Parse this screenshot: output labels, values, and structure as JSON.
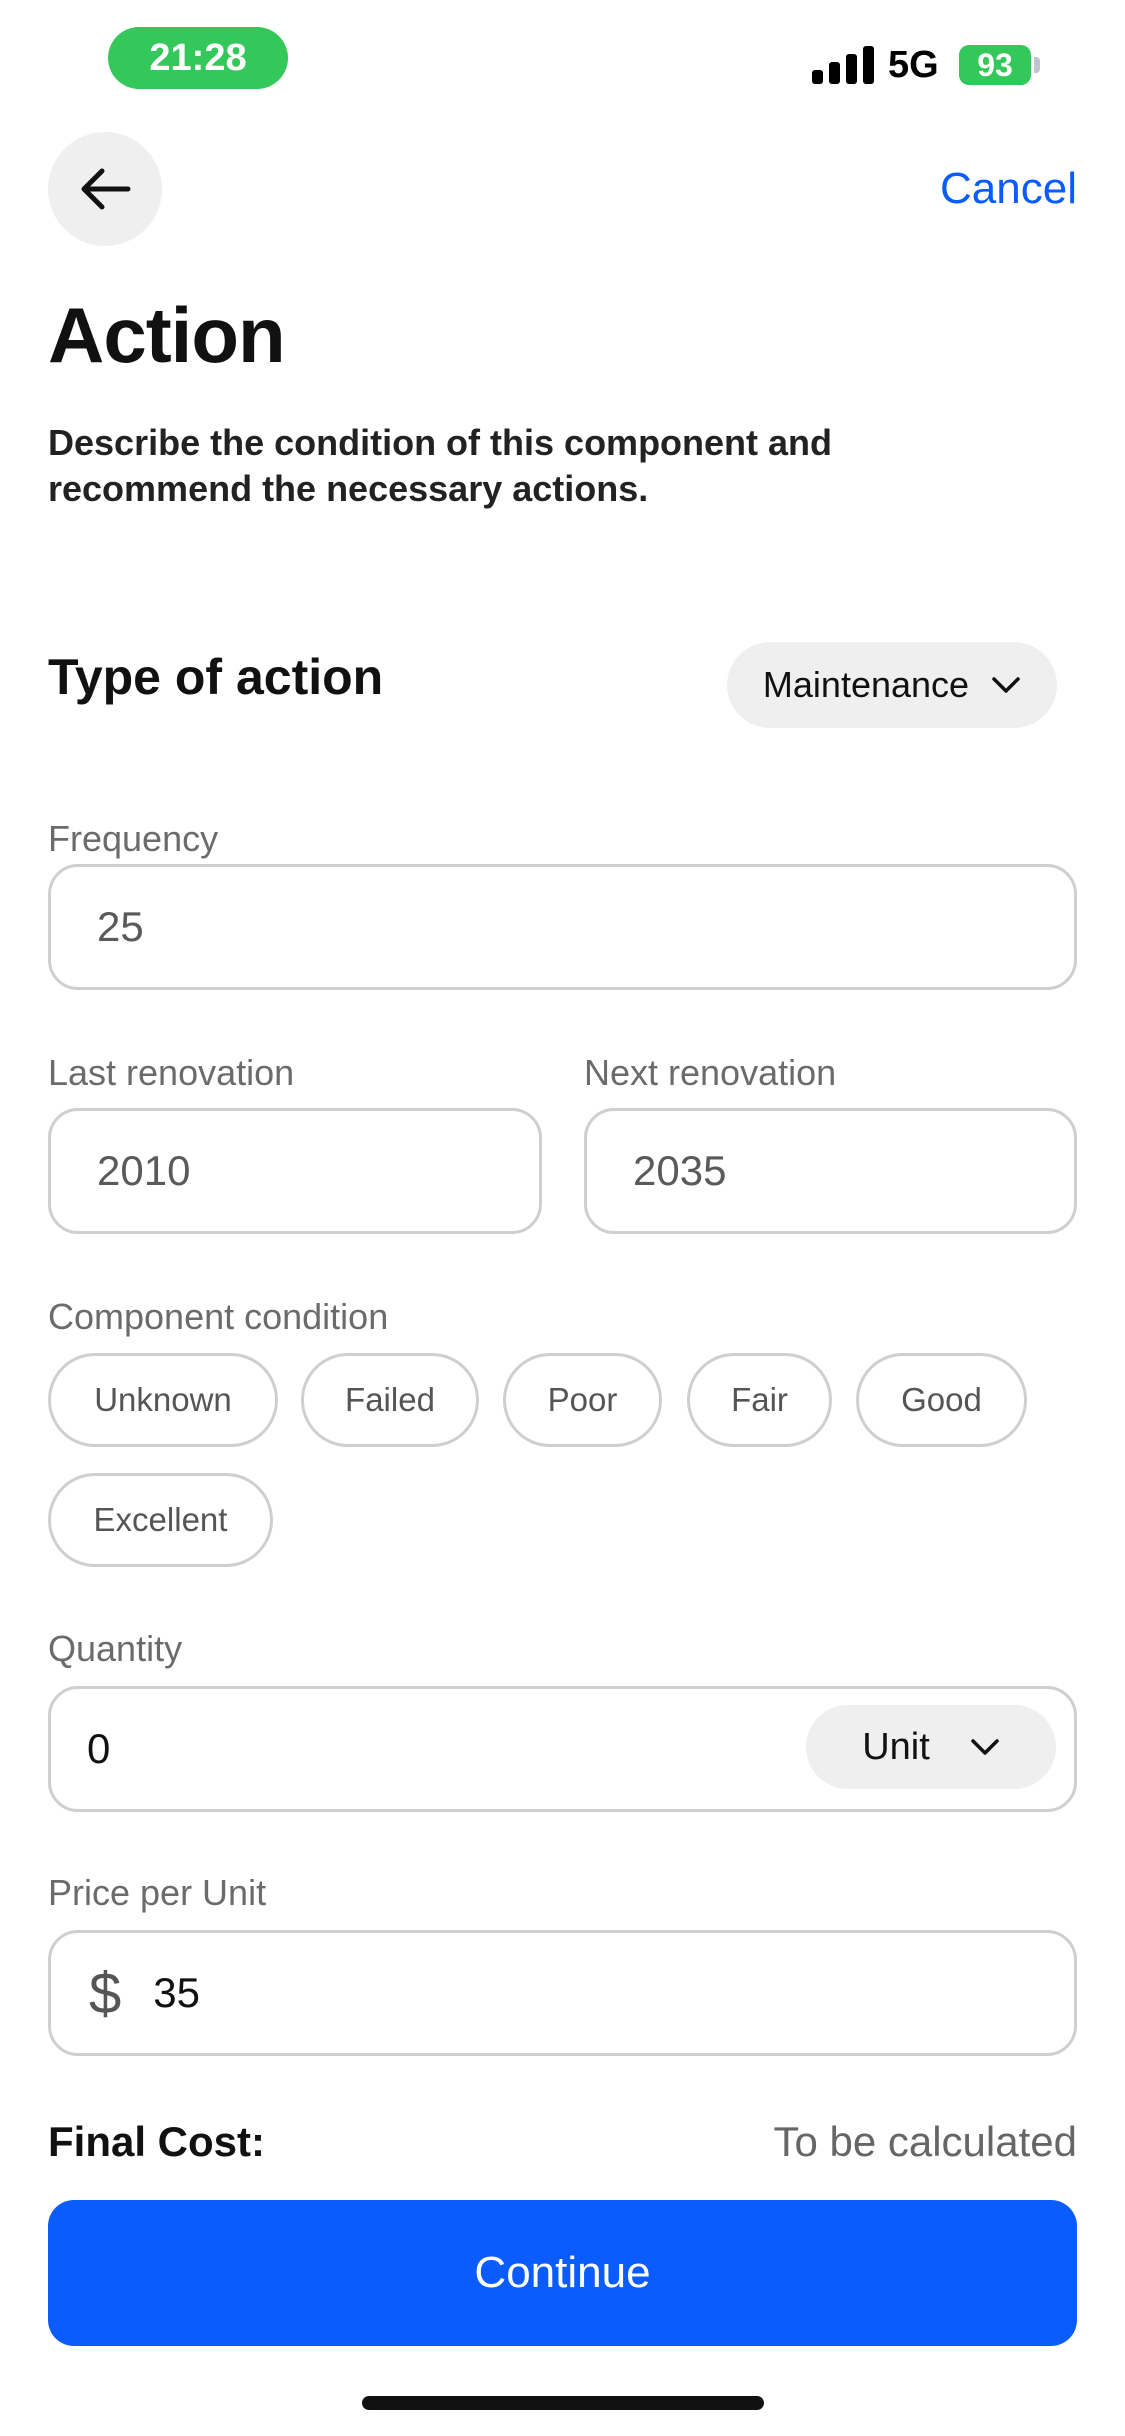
{
  "status_bar": {
    "time": "21:28",
    "network": "5G",
    "battery": "93",
    "accent_color": "#34c759"
  },
  "nav": {
    "back_icon": "arrow-left-icon",
    "cancel_label": "Cancel"
  },
  "page": {
    "title": "Action",
    "subtitle": "Describe the condition of this component and recommend the necessary actions."
  },
  "type_of_action": {
    "label": "Type of action",
    "selected": "Maintenance"
  },
  "frequency": {
    "label": "Frequency",
    "value": "25"
  },
  "last_renovation": {
    "label": "Last renovation",
    "value": "2010"
  },
  "next_renovation": {
    "label": "Next renovation",
    "value": "2035"
  },
  "component_condition": {
    "label": "Component condition",
    "options": [
      "Unknown",
      "Failed",
      "Poor",
      "Fair",
      "Good",
      "Excellent"
    ]
  },
  "quantity": {
    "label": "Quantity",
    "value": "0",
    "unit_selected": "Unit"
  },
  "price_per_unit": {
    "label": "Price per Unit",
    "currency_symbol": "$",
    "value": "35"
  },
  "final_cost": {
    "label": "Final Cost:",
    "value": "To be calculated"
  },
  "continue_label": "Continue",
  "colors": {
    "primary": "#0a5cff",
    "field_border": "#cfcfcf",
    "chip_bg": "#efefef"
  }
}
